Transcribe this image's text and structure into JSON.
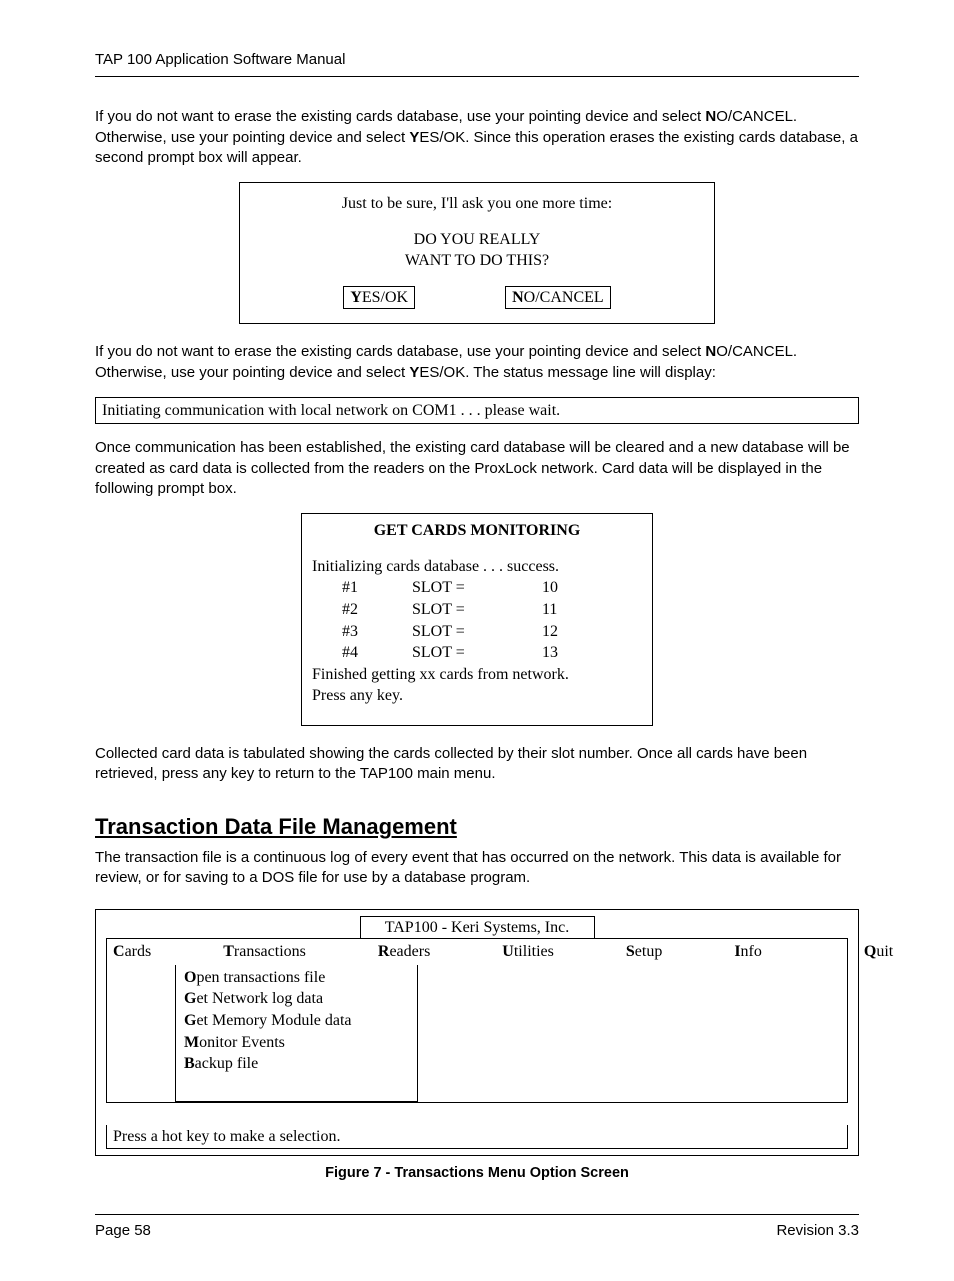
{
  "header": {
    "title": "TAP 100 Application Software Manual"
  },
  "para1": "If you do not want to erase the existing cards database, use your pointing device and select ",
  "para1b": "O/CANCEL. Otherwise, use your pointing device and select ",
  "para1c": "ES/OK. Since this operation erases the existing cards database, a second prompt box will appear.",
  "dialog": {
    "line1": "Just to be sure, I'll ask you one more time:",
    "line2": "DO YOU REALLY",
    "line3": "WANT TO DO THIS?",
    "yes_rest": "ES/OK",
    "no_rest": "O/CANCEL"
  },
  "para2a": "If you do not want to erase the existing cards database, use your pointing device and select ",
  "para2b": "O/CANCEL. Otherwise, use your pointing device and select ",
  "para2c": "ES/OK. The status message line will display:",
  "status_msg": "Initiating communication with local network on COM1 . . . please wait.",
  "para3": "Once communication has been established, the existing card database will be cleared and a new database will be created as card data is collected from the readers on the ProxLock network. Card data will be displayed in the following prompt box.",
  "monitor": {
    "title": "GET CARDS MONITORING",
    "init": "Initializing cards database . . . success.",
    "rows": [
      {
        "id": "#1",
        "label": "SLOT =",
        "val": "10"
      },
      {
        "id": "#2",
        "label": "SLOT =",
        "val": "11"
      },
      {
        "id": "#3",
        "label": "SLOT =",
        "val": "12"
      },
      {
        "id": "#4",
        "label": "SLOT =",
        "val": "13"
      }
    ],
    "finished": "Finished getting xx cards from network.",
    "press": "Press any key."
  },
  "para4": "Collected card data is tabulated showing the cards collected by their slot number. Once all cards have been retrieved, press any key to return to the TAP100 main menu.",
  "section_heading": "Transaction Data File Management",
  "para5": "The transaction file is a continuous log of every event that has occurred on the network. This data is available for review, or for saving to a DOS file for use by a database program.",
  "app": {
    "title": "TAP100 - Keri Systems, Inc.",
    "menu": {
      "cards": "ards",
      "transactions": "ransactions",
      "readers": "eaders",
      "utilities": "tilities",
      "setup": "etup",
      "info": "nfo",
      "quit": "uit"
    },
    "dropdown": {
      "open": "pen transactions file",
      "getnet": "et Network log data",
      "getmem": "et Memory Module data",
      "monitor": "onitor Events",
      "backup": "ackup file"
    },
    "status": "Press a hot key to make a selection."
  },
  "figure_caption": "Figure 7 - Transactions Menu Option Screen",
  "footer": {
    "left": "Page 58",
    "right": "Revision 3.3"
  },
  "bold_N": "N",
  "bold_Y": "Y",
  "bold_C": "C",
  "bold_T": "T",
  "bold_R": "R",
  "bold_U": "U",
  "bold_S": "S",
  "bold_I": "I",
  "bold_Q": "Q",
  "bold_O": "O",
  "bold_G": "G",
  "bold_M": "M",
  "bold_B": "B"
}
